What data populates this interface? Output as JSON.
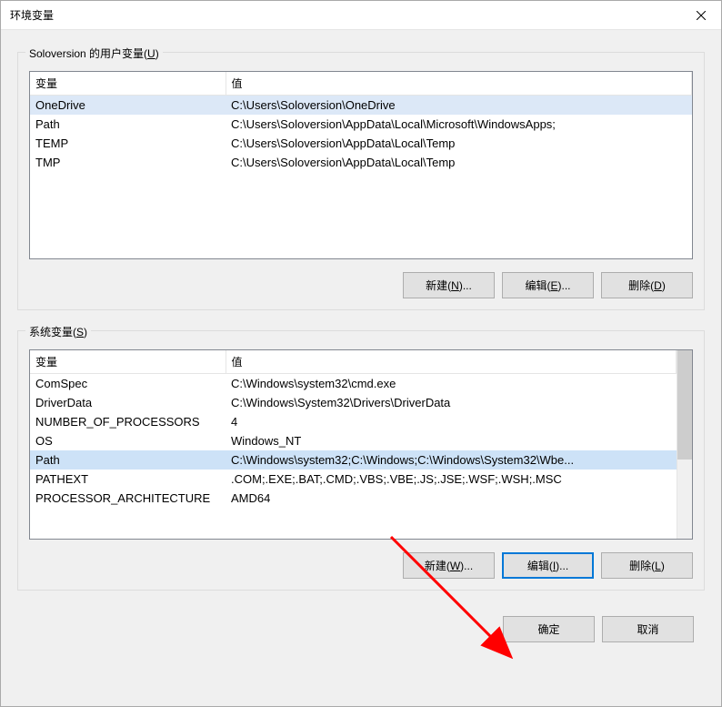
{
  "window": {
    "title": "环境变量"
  },
  "user_section": {
    "label_prefix": "Soloversion 的用户变量(",
    "label_key": "U",
    "label_suffix": ")",
    "col_var": "变量",
    "col_val": "值",
    "rows": [
      {
        "name": "OneDrive",
        "value": "C:\\Users\\Soloversion\\OneDrive",
        "selected": true
      },
      {
        "name": "Path",
        "value": "C:\\Users\\Soloversion\\AppData\\Local\\Microsoft\\WindowsApps;"
      },
      {
        "name": "TEMP",
        "value": "C:\\Users\\Soloversion\\AppData\\Local\\Temp"
      },
      {
        "name": "TMP",
        "value": "C:\\Users\\Soloversion\\AppData\\Local\\Temp"
      }
    ],
    "buttons": {
      "new_prefix": "新建(",
      "new_key": "N",
      "new_suffix": ")...",
      "edit_prefix": "编辑(",
      "edit_key": "E",
      "edit_suffix": ")...",
      "del_prefix": "删除(",
      "del_key": "D",
      "del_suffix": ")"
    }
  },
  "sys_section": {
    "label_prefix": "系统变量(",
    "label_key": "S",
    "label_suffix": ")",
    "col_var": "变量",
    "col_val": "值",
    "rows": [
      {
        "name": "ComSpec",
        "value": "C:\\Windows\\system32\\cmd.exe"
      },
      {
        "name": "DriverData",
        "value": "C:\\Windows\\System32\\Drivers\\DriverData"
      },
      {
        "name": "NUMBER_OF_PROCESSORS",
        "value": "4"
      },
      {
        "name": "OS",
        "value": "Windows_NT"
      },
      {
        "name": "Path",
        "value": "C:\\Windows\\system32;C:\\Windows;C:\\Windows\\System32\\Wbe...",
        "selected": true
      },
      {
        "name": "PATHEXT",
        "value": ".COM;.EXE;.BAT;.CMD;.VBS;.VBE;.JS;.JSE;.WSF;.WSH;.MSC"
      },
      {
        "name": "PROCESSOR_ARCHITECTURE",
        "value": "AMD64"
      }
    ],
    "buttons": {
      "new_prefix": "新建(",
      "new_key": "W",
      "new_suffix": ")...",
      "edit_prefix": "编辑(",
      "edit_key": "I",
      "edit_suffix": ")...",
      "del_prefix": "删除(",
      "del_key": "L",
      "del_suffix": ")"
    }
  },
  "footer": {
    "ok": "确定",
    "cancel": "取消"
  }
}
